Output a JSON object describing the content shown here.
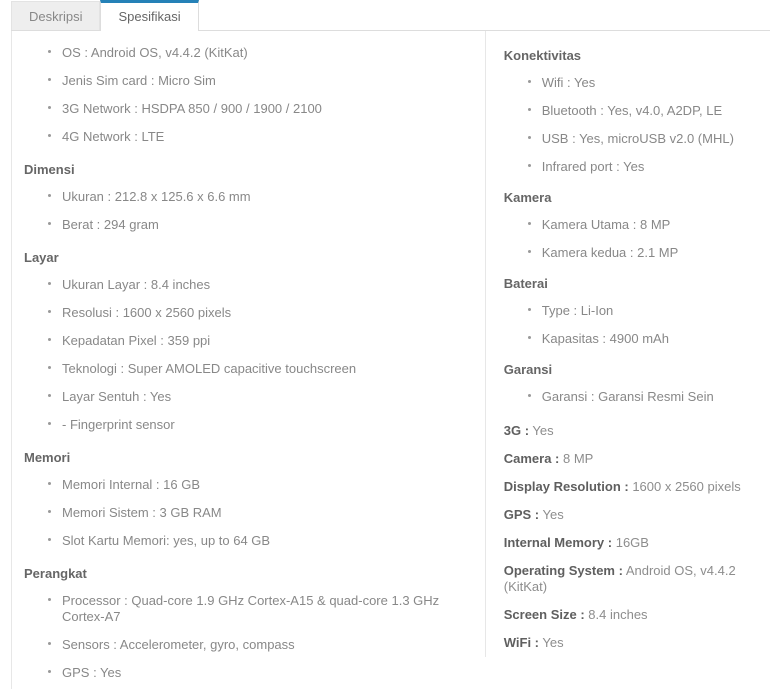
{
  "tabs": [
    {
      "label": "Deskripsi",
      "active": false,
      "name": "tab-deskripsi"
    },
    {
      "label": "Spesifikasi",
      "active": true,
      "name": "tab-spesifikasi"
    }
  ],
  "accent_color": "#2581b7",
  "left_column": {
    "sections": [
      {
        "heading": null,
        "items": [
          "OS : Android OS, v4.4.2 (KitKat)",
          "Jenis Sim card : Micro Sim",
          "3G Network : HSDPA 850 / 900 / 1900 / 2100",
          "4G Network : LTE"
        ]
      },
      {
        "heading": "Dimensi",
        "items": [
          "Ukuran : 212.8 x 125.6 x 6.6 mm",
          "Berat : 294 gram"
        ]
      },
      {
        "heading": "Layar",
        "items": [
          "Ukuran Layar : 8.4 inches",
          "Resolusi : 1600 x 2560 pixels",
          "Kepadatan Pixel : 359 ppi",
          "Teknologi : Super AMOLED capacitive touchscreen",
          "Layar Sentuh : Yes",
          "- Fingerprint sensor"
        ]
      },
      {
        "heading": "Memori",
        "items": [
          "Memori Internal : 16 GB",
          "Memori Sistem : 3 GB RAM",
          "Slot Kartu Memori: yes, up to 64 GB"
        ]
      },
      {
        "heading": "Perangkat",
        "items": [
          "Processor : Quad-core 1.9 GHz Cortex-A15 & quad-core 1.3 GHz Cortex-A7",
          "Sensors : Accelerometer, gyro, compass",
          "GPS : Yes"
        ]
      }
    ]
  },
  "right_column": {
    "sections": [
      {
        "heading": "Konektivitas",
        "items": [
          "Wifi : Yes",
          "Bluetooth : Yes, v4.0, A2DP, LE",
          "USB : Yes, microUSB v2.0 (MHL)",
          "Infrared port : Yes"
        ]
      },
      {
        "heading": "Kamera",
        "items": [
          "Kamera Utama : 8 MP",
          "Kamera kedua : 2.1 MP"
        ]
      },
      {
        "heading": "Baterai",
        "items": [
          "Type : Li-Ion",
          "Kapasitas : 4900 mAh"
        ]
      },
      {
        "heading": "Garansi",
        "items": [
          "Garansi : Garansi Resmi Sein"
        ]
      }
    ],
    "key_values": [
      {
        "key": "3G :",
        "value": "Yes"
      },
      {
        "key": "Camera :",
        "value": "8 MP"
      },
      {
        "key": "Display Resolution :",
        "value": "1600 x 2560 pixels"
      },
      {
        "key": "GPS :",
        "value": "Yes"
      },
      {
        "key": "Internal Memory :",
        "value": "16GB"
      },
      {
        "key": "Operating System :",
        "value": "Android OS, v4.4.2 (KitKat)"
      },
      {
        "key": "Screen Size :",
        "value": "8.4 inches"
      },
      {
        "key": "WiFi :",
        "value": "Yes"
      }
    ]
  }
}
